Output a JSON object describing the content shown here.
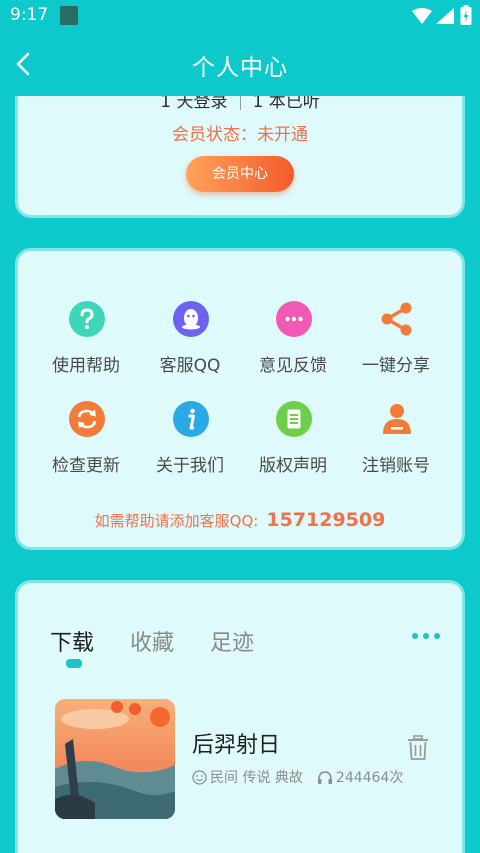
{
  "status_bar": {
    "time": "9:17"
  },
  "header": {
    "title": "个人中心"
  },
  "profile": {
    "stat_1": "1 天登录",
    "stat_2": "1 本已听",
    "vip_status": "会员状态：未开通",
    "vip_button": "会员中心"
  },
  "services": {
    "items": [
      {
        "label": "使用帮助",
        "icon": "help-icon",
        "color": "#3ed6b8"
      },
      {
        "label": "客服QQ",
        "icon": "qq-icon",
        "color": "#6c63f0"
      },
      {
        "label": "意见反馈",
        "icon": "chat-bubble-icon",
        "color": "#f05ab4"
      },
      {
        "label": "一键分享",
        "icon": "share-icon",
        "color": "#f27b3a"
      },
      {
        "label": "检查更新",
        "icon": "refresh-icon",
        "color": "#f27b3a"
      },
      {
        "label": "关于我们",
        "icon": "info-icon",
        "color": "#29a9e6"
      },
      {
        "label": "版权声明",
        "icon": "document-icon",
        "color": "#6ed04a"
      },
      {
        "label": "注销账号",
        "icon": "user-icon",
        "color": "#f27b3a"
      }
    ],
    "help_text": "如需帮助请添加客服QQ:",
    "help_qq": "157129509"
  },
  "library": {
    "tabs": [
      "下载",
      "收藏",
      "足迹"
    ],
    "active_tab": "下载",
    "items": [
      {
        "title": "后羿射日",
        "tags": "民间 传说 典故",
        "plays": "244464次"
      }
    ]
  },
  "colors": {
    "background": "#0ec9cc",
    "card": "#dffafa",
    "accent": "#f0714a",
    "tab_indicator": "#1fc3c3"
  }
}
